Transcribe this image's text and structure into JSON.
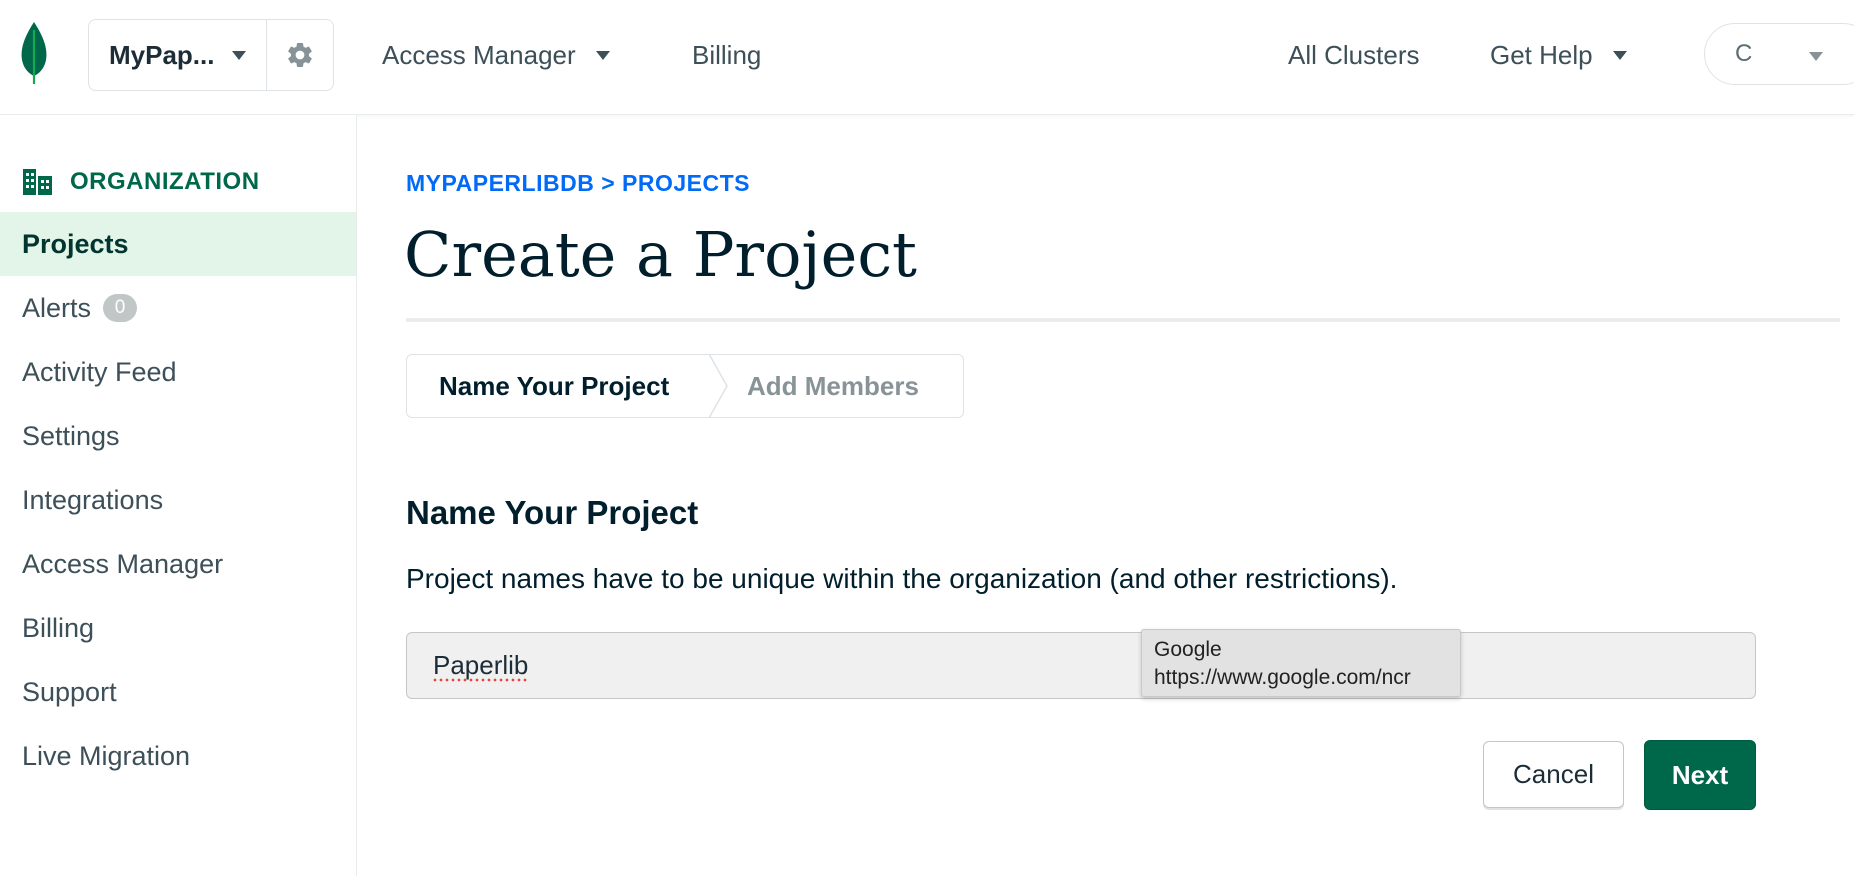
{
  "topbar": {
    "org_name": "MyPap...",
    "nav": [
      {
        "label": "Access Manager"
      },
      {
        "label": "Billing"
      },
      {
        "label": "All Clusters"
      },
      {
        "label": "Get Help"
      }
    ],
    "user_initial": "C"
  },
  "sidebar": {
    "header": "ORGANIZATION",
    "items": [
      {
        "label": "Projects"
      },
      {
        "label": "Alerts",
        "badge": "0"
      },
      {
        "label": "Activity Feed"
      },
      {
        "label": "Settings"
      },
      {
        "label": "Integrations"
      },
      {
        "label": "Access Manager"
      },
      {
        "label": "Billing"
      },
      {
        "label": "Support"
      },
      {
        "label": "Live Migration"
      }
    ]
  },
  "main": {
    "breadcrumb": "MYPAPERLIBDB > PROJECTS",
    "title": "Create a Project",
    "steps": [
      {
        "label": "Name Your Project"
      },
      {
        "label": "Add Members"
      }
    ],
    "section_title": "Name Your Project",
    "section_desc": "Project names have to be unique within the organization (and other restrictions).",
    "project_name_value": "Paperlib",
    "autofill": {
      "title": "Google",
      "url": "https://www.google.com/ncr"
    },
    "cancel_label": "Cancel",
    "next_label": "Next"
  },
  "colors": {
    "brand_green": "#00684a",
    "link_blue": "#016bf8",
    "active_bg": "#e3f4e8"
  }
}
